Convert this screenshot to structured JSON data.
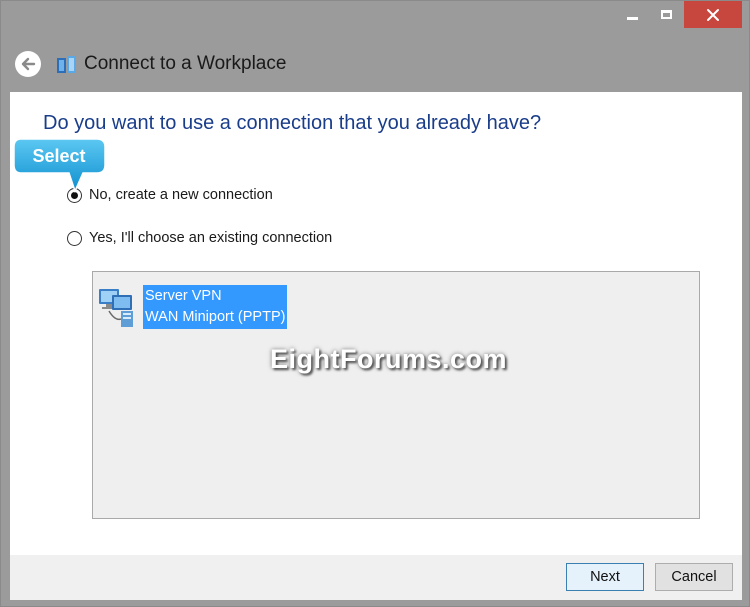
{
  "window": {
    "title": "Connect to a Workplace"
  },
  "content": {
    "question": "Do you want to use a connection that you already have?",
    "options": [
      {
        "label": "No, create a new connection",
        "selected": true
      },
      {
        "label": "Yes, I'll choose an existing connection",
        "selected": false
      }
    ],
    "connection": {
      "name": "Server VPN",
      "device": "WAN Miniport (PPTP)"
    },
    "watermark": "EightForums.com"
  },
  "callout": {
    "label": "Select"
  },
  "footer": {
    "next_label": "Next",
    "cancel_label": "Cancel"
  },
  "colors": {
    "accent": "#1a3d8a",
    "selection": "#3399ff",
    "close": "#c7463d",
    "callout": "#1aa3dc"
  }
}
